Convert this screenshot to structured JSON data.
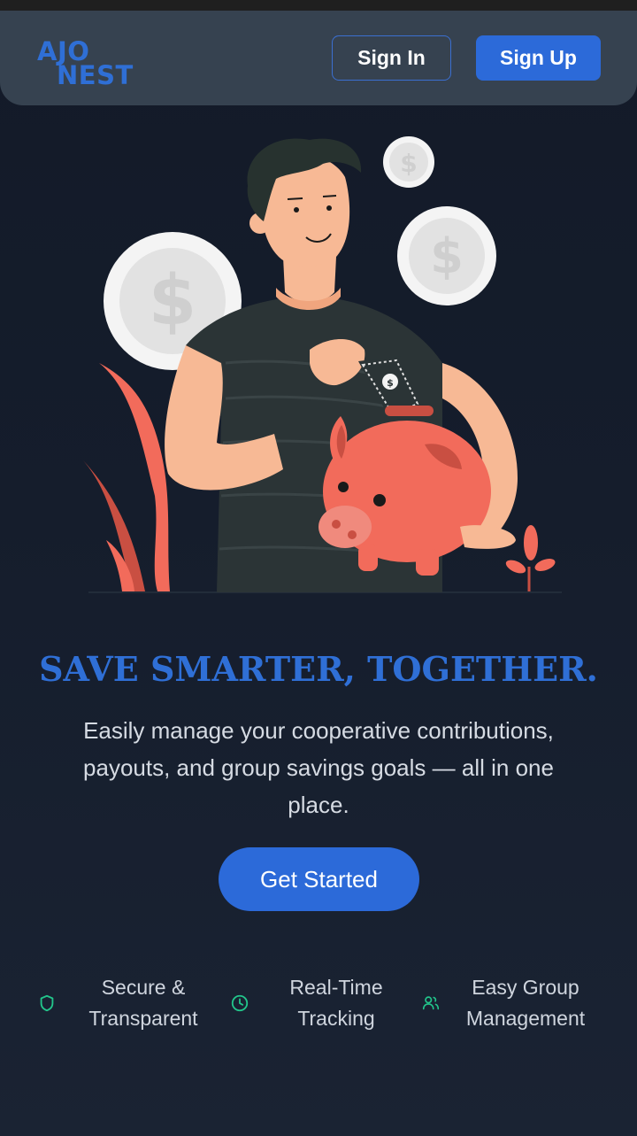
{
  "nav": {
    "logo_line1": "AJO",
    "logo_line2": "NEST",
    "signin_label": "Sign In",
    "signup_label": "Sign Up"
  },
  "hero": {
    "headline": "SAVE SMARTER, TOGETHER.",
    "subtext": "Easily manage your cooperative contributions, payouts, and group savings goals — all in one place.",
    "cta_label": "Get Started",
    "illustration": "person-saving-money-in-piggy-bank"
  },
  "features": [
    {
      "icon": "shield-icon",
      "line1": "Secure &",
      "line2": "Transparent"
    },
    {
      "icon": "clock-icon",
      "line1": "Real-Time",
      "line2": "Tracking"
    },
    {
      "icon": "users-icon",
      "line1": "Easy Group",
      "line2": "Management"
    }
  ],
  "colors": {
    "brand_blue": "#2c6ad9",
    "background": "#151d2c",
    "navbar": "#364250",
    "feature_icon": "#22c58b",
    "accent_coral": "#f26b5b"
  }
}
